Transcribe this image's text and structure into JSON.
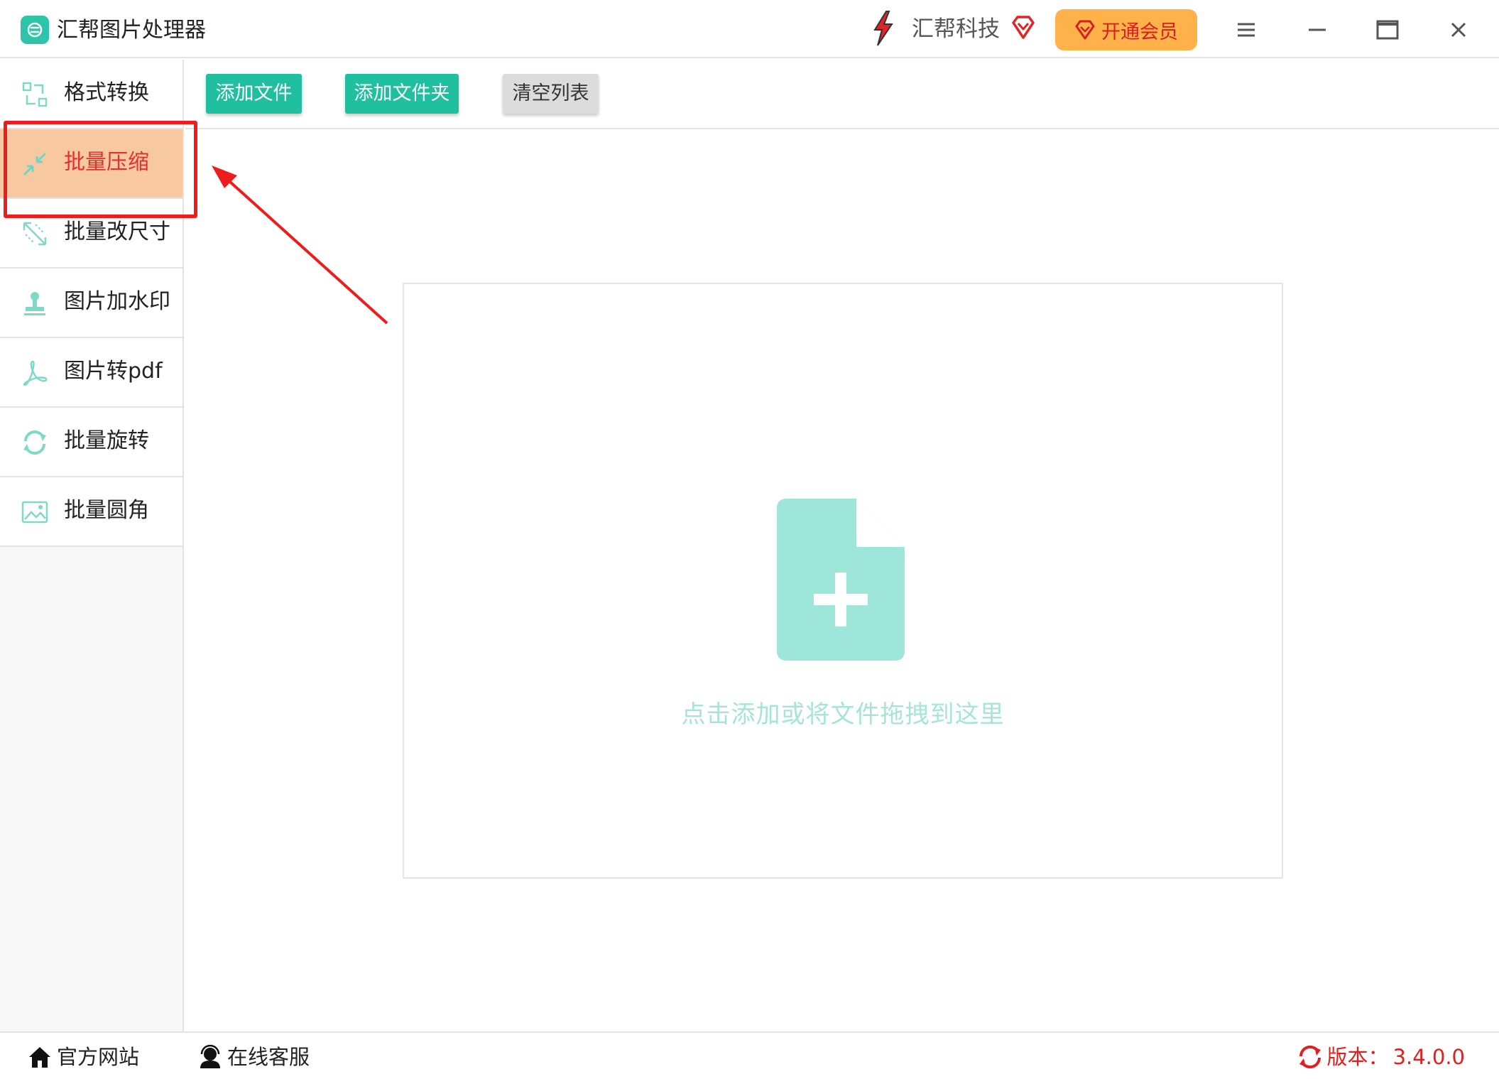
{
  "app": {
    "title": "汇帮图片处理器"
  },
  "brand": {
    "name": "汇帮科技",
    "vip_label": "开通会员"
  },
  "sidebar": {
    "items": [
      {
        "label": "格式转换",
        "icon": "format-convert-icon",
        "active": false
      },
      {
        "label": "批量压缩",
        "icon": "compress-icon",
        "active": true
      },
      {
        "label": "批量改尺寸",
        "icon": "resize-icon",
        "active": false
      },
      {
        "label": "图片加水印",
        "icon": "watermark-stamp-icon",
        "active": false
      },
      {
        "label": "图片转pdf",
        "icon": "pdf-icon",
        "active": false
      },
      {
        "label": "批量旋转",
        "icon": "rotate-icon",
        "active": false
      },
      {
        "label": "批量圆角",
        "icon": "image-corner-icon",
        "active": false
      }
    ]
  },
  "toolbar": {
    "add_file_label": "添加文件",
    "add_folder_label": "添加文件夹",
    "clear_list_label": "清空列表"
  },
  "dropzone": {
    "hint": "点击添加或将文件拖拽到这里"
  },
  "statusbar": {
    "website_label": "官方网站",
    "support_label": "在线客服",
    "version_label": "版本：",
    "version_value": "3.4.0.0"
  },
  "colors": {
    "accent_green": "#1fbfa0",
    "active_item_bg": "#f8c8a0",
    "active_item_text": "#e03030",
    "vip_bg": "#ffb24a",
    "annotation_red": "#ee1c1c",
    "drop_icon": "#9ee6da"
  }
}
